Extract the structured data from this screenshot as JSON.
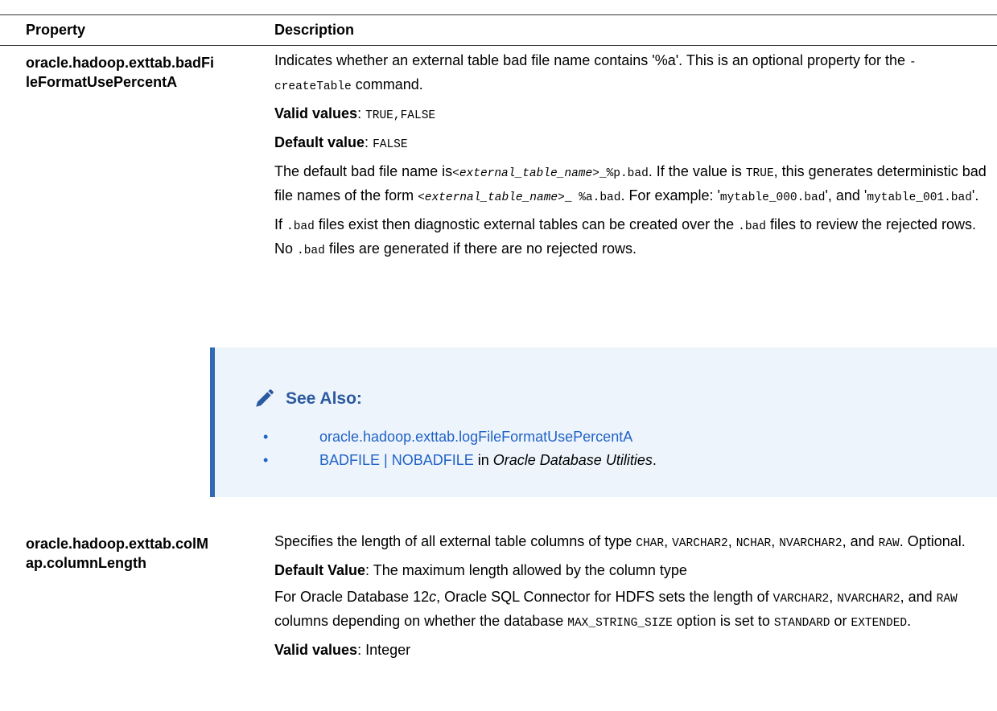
{
  "table": {
    "col_property": "Property",
    "col_description": "Description"
  },
  "row1": {
    "property_line1": "oracle.hadoop.exttab.badFi",
    "property_line2": "leFormatUsePercentA",
    "desc_intro_a": "Indicates whether an external table bad file name contains '%a'. This is an optional property for the ",
    "desc_intro_code": "-createTable",
    "desc_intro_b": " command.",
    "valid_label": "Valid values",
    "valid_value": "TRUE,FALSE",
    "default_label": "Default value",
    "default_value": "FALSE",
    "p3_a": "The default bad file name is",
    "p3_code1": "<external_table_name>",
    "p3_code2": "_%p.bad",
    "p3_b": ". If the value is ",
    "p3_code3": "TRUE",
    "p3_c": ", this generates deterministic bad file names of the form ",
    "p3_code4": "<external_table_name>",
    "p3_code5": "_ %a.bad",
    "p3_d": ". For example: '",
    "p3_code6": "mytable_000.bad",
    "p3_e": "', and '",
    "p3_code7": "mytable_001.bad",
    "p3_f": "'.",
    "p4_a": "If ",
    "p4_code1": ".bad",
    "p4_b": " files exist then diagnostic external tables can be created over the ",
    "p4_code2": ".bad",
    "p4_c": " files to review the rejected rows. No ",
    "p4_code3": ".bad",
    "p4_d": " files are generated if there are no rejected rows."
  },
  "see_also": {
    "title": "See Also:",
    "link1": "oracle.hadoop.exttab.logFileFormatUsePercentA",
    "link2": "BADFILE | NOBADFILE",
    "link2_suffix_a": " in ",
    "link2_suffix_italic": "Oracle Database Utilities",
    "link2_suffix_b": "."
  },
  "row2": {
    "property_line1": "oracle.hadoop.exttab.colM",
    "property_line2": "ap.columnLength",
    "p1_a": "Specifies the length of all external table columns of type ",
    "p1_code1": "CHAR",
    "p1_b": ", ",
    "p1_code2": "VARCHAR2",
    "p1_c": ", ",
    "p1_code3": "NCHAR",
    "p1_d": ", ",
    "p1_code4": "NVARCHAR2",
    "p1_e": ", and ",
    "p1_code5": "RAW",
    "p1_f": ". Optional.",
    "default_label": "Default Value",
    "default_value": ": The maximum length allowed by the column type",
    "p3_a": "For Oracle Database 12",
    "p3_italic": "c",
    "p3_b": ", Oracle SQL Connector for HDFS sets the length of ",
    "p3_code1": "VARCHAR2",
    "p3_c": ", ",
    "p3_code2": "NVARCHAR2",
    "p3_d": ", and ",
    "p3_code3": "RAW",
    "p3_e": " columns depending on whether the database ",
    "p3_code4": "MAX_STRING_SIZE",
    "p3_f": " option is set to ",
    "p3_code5": "STANDARD",
    "p3_g": " or ",
    "p3_code6": "EXTENDED",
    "p3_h": ".",
    "valid_label": "Valid values",
    "valid_value": ": Integer"
  }
}
